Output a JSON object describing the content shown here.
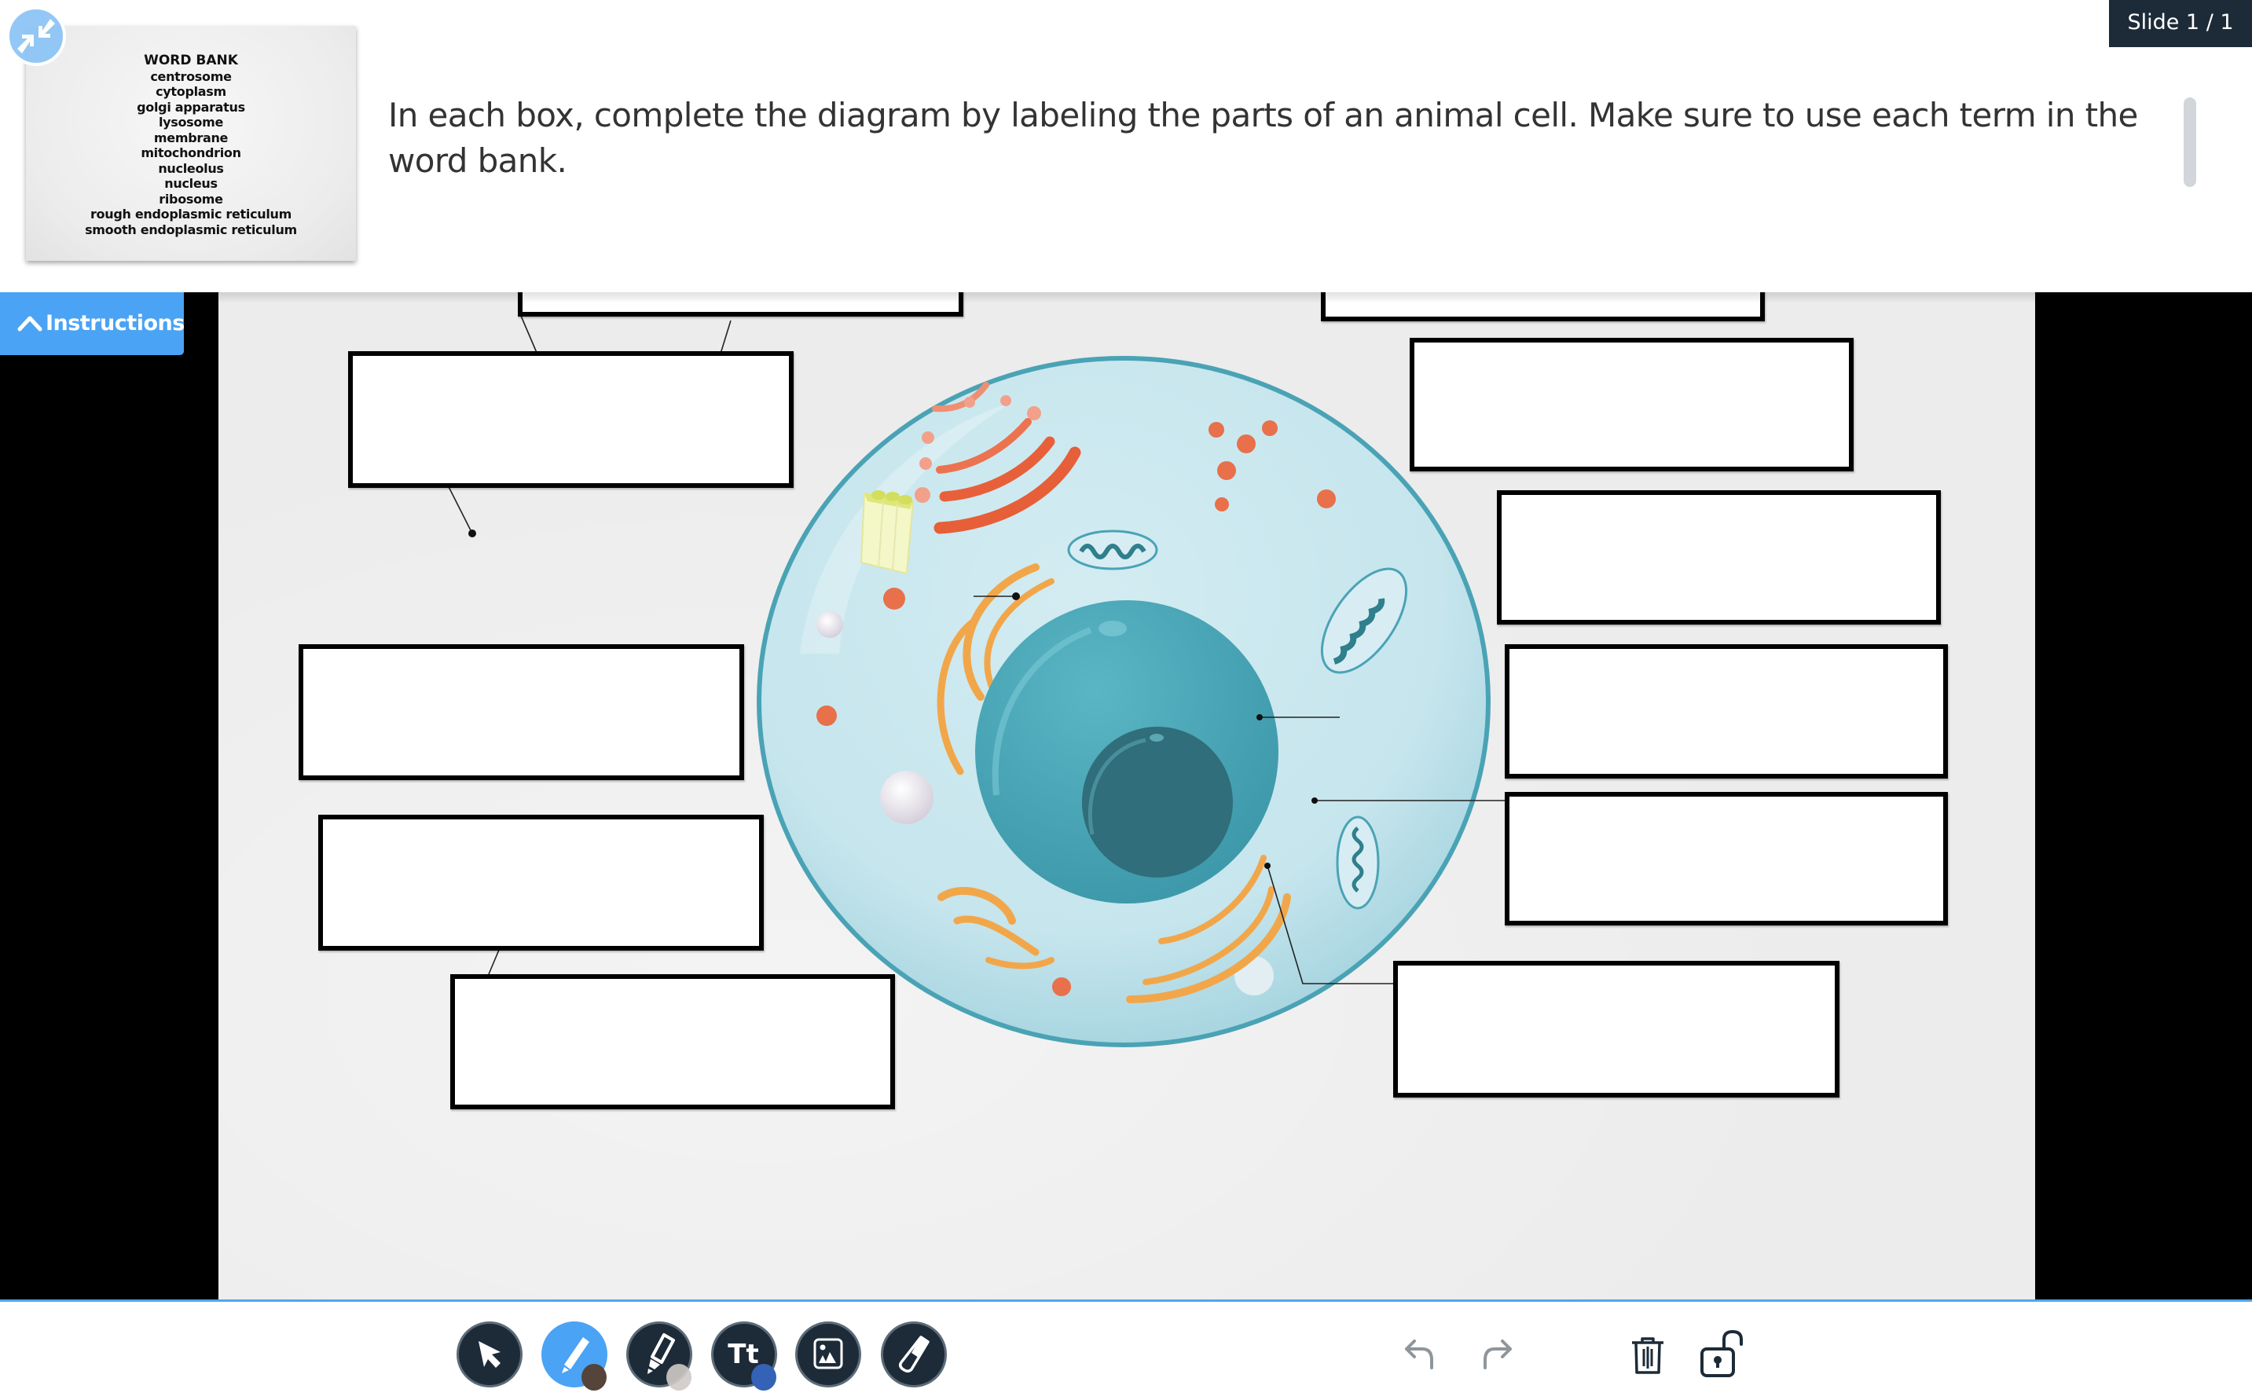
{
  "header": {
    "instructions_text": "In each box, complete the diagram by labeling the parts of an animal cell. Make sure to use each term in the word bank.",
    "slide_indicator": "Slide 1 / 1",
    "collapse_icon": "collapse-arrows-icon"
  },
  "word_bank": {
    "title": "WORD BANK",
    "items": [
      "centrosome",
      "cytoplasm",
      "golgi apparatus",
      "lysosome",
      "membrane",
      "mitochondrion",
      "nucleolus",
      "nucleus",
      "ribosome",
      "rough endoplasmic reticulum",
      "smooth endoplasmic reticulum"
    ]
  },
  "instructions_tab": {
    "label": "Instructions",
    "icon": "chevron-up-icon"
  },
  "diagram": {
    "subject": "animal cell",
    "label_boxes": [
      {
        "id": "top-left",
        "value": ""
      },
      {
        "id": "top-right",
        "value": ""
      },
      {
        "id": "left-1",
        "value": ""
      },
      {
        "id": "left-2",
        "value": ""
      },
      {
        "id": "left-3",
        "value": ""
      },
      {
        "id": "left-4",
        "value": ""
      },
      {
        "id": "right-1",
        "value": ""
      },
      {
        "id": "right-2",
        "value": ""
      },
      {
        "id": "right-3",
        "value": ""
      },
      {
        "id": "right-4",
        "value": ""
      },
      {
        "id": "right-5",
        "value": ""
      }
    ],
    "colors": {
      "cytoplasm": "#c9e6ee",
      "membrane": "#4aa3b5",
      "nucleus": "#4aa6b6",
      "nucleolus": "#2f6e7a",
      "ribosome": "#e8704a",
      "golgi": "#f2a64a",
      "centrosome": "#f3f5c4"
    }
  },
  "toolbar": {
    "tools": [
      {
        "name": "select",
        "icon": "cursor-arrow-icon",
        "active": false
      },
      {
        "name": "pen",
        "icon": "pencil-icon",
        "active": true,
        "color": "#54443a"
      },
      {
        "name": "highlighter",
        "icon": "highlighter-icon",
        "active": false,
        "color": "#cfcac6"
      },
      {
        "name": "text",
        "icon": "text-tt-icon",
        "label": "Tt",
        "active": false,
        "color": "#3462b6"
      },
      {
        "name": "image",
        "icon": "image-icon",
        "active": false
      },
      {
        "name": "eraser",
        "icon": "eraser-icon",
        "active": false
      }
    ],
    "undo_icon": "undo-icon",
    "redo_icon": "redo-icon",
    "delete_icon": "trash-icon",
    "lock_icon": "unlock-icon"
  },
  "accent_color": "#4aa3f4",
  "dark_color": "#1d2b38"
}
